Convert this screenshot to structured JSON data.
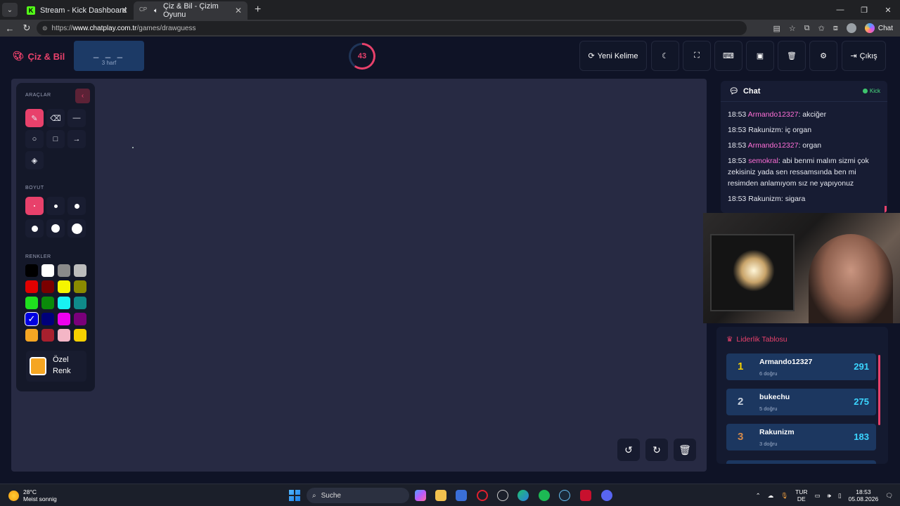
{
  "browser": {
    "tabs": [
      {
        "title": "Stream - Kick Dashboard",
        "active": false
      },
      {
        "title": "Çiz & Bil - Çizim Oyunu",
        "active": true,
        "favicon_text": "CP"
      }
    ],
    "url_prefix": "https://",
    "url_host": "www.chatplay.com.tr",
    "url_path": "/games/drawguess",
    "chat_label": "Chat"
  },
  "header": {
    "brand": "Çiz & Bil",
    "word_blanks": "_ _ _",
    "word_hint": "3 harf",
    "timer": "43",
    "buttons": {
      "new_word": "Yeni Kelime",
      "logout": "Çıkış"
    }
  },
  "tools": {
    "section_tools": "ARAÇLAR",
    "section_size": "BOYUT",
    "section_colors": "RENKLER",
    "custom_color_line1": "Özel",
    "custom_color_line2": "Renk",
    "colors": [
      "#000000",
      "#ffffff",
      "#8a8a8a",
      "#bcbcbc",
      "#e00000",
      "#7a0000",
      "#f5f500",
      "#8a8a00",
      "#1fe01f",
      "#0a8a0a",
      "#18f2f2",
      "#0f8a8a",
      "#0000e0",
      "#00007a",
      "#ee00ee",
      "#7a007a",
      "#f5a623",
      "#a8202e",
      "#f4b6c6",
      "#f5d000"
    ],
    "custom_color": "#f5a623",
    "accent": "#e8416b"
  },
  "chat": {
    "title": "Chat",
    "status": "Kick",
    "messages": [
      {
        "time": "18:53",
        "user": "Armando12327",
        "text": ": akciğer",
        "highlight": true
      },
      {
        "time": "18:53",
        "user": "Rakunizm",
        "text": ": iç organ",
        "highlight": false
      },
      {
        "time": "18:53",
        "user": "Armando12327",
        "text": ": organ",
        "highlight": true
      },
      {
        "time": "18:53",
        "user": "semokral",
        "text": ": abi benmi malım sizmi çok zekisiniz yada sen ressamsında ben mi resimden anlamıyom sız ne yapıyonuz",
        "highlight": true
      },
      {
        "time": "18:53",
        "user": "Rakunizm",
        "text": ": sigara",
        "highlight": false
      }
    ]
  },
  "leaderboard": {
    "title": "Liderlik Tablosu",
    "entries": [
      {
        "rank": "1",
        "name": "Armando12327",
        "sub": "6 doğru",
        "score": "291",
        "rank_color": "#f5d000"
      },
      {
        "rank": "2",
        "name": "bukechu",
        "sub": "5 doğru",
        "score": "275",
        "rank_color": "#c8d0dc"
      },
      {
        "rank": "3",
        "name": "Rakunizm",
        "sub": "3 doğru",
        "score": "183",
        "rank_color": "#d4894a"
      }
    ]
  },
  "taskbar": {
    "temp": "28°C",
    "weather": "Meist sonnig",
    "search": "Suche",
    "lang1": "TUR",
    "lang2": "DE",
    "time": "18:53",
    "date": "05.08.2026"
  }
}
